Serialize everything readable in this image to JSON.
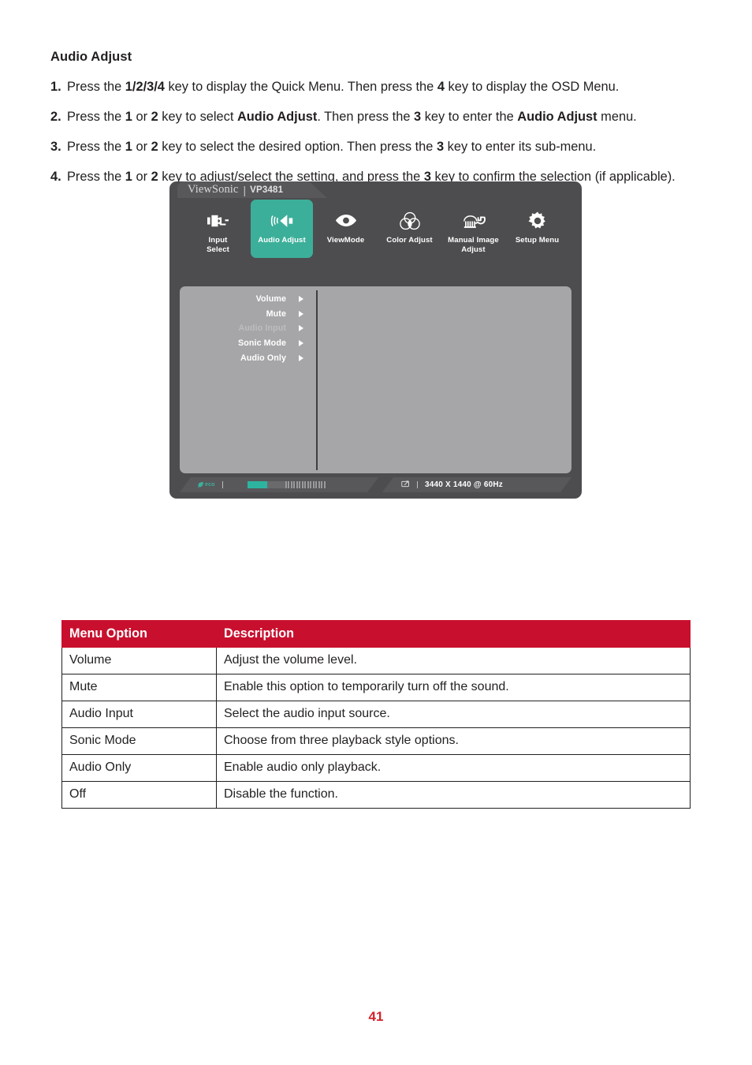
{
  "section": {
    "title": "Audio Adjust"
  },
  "steps": [
    {
      "num": "1.",
      "parts": [
        {
          "t": "Press the ",
          "b": false
        },
        {
          "t": "1/2/3/4",
          "b": true
        },
        {
          "t": " key to display the Quick Menu. Then press the ",
          "b": false
        },
        {
          "t": "4",
          "b": true
        },
        {
          "t": " key to display the OSD Menu.",
          "b": false
        }
      ]
    },
    {
      "num": "2.",
      "parts": [
        {
          "t": "Press the ",
          "b": false
        },
        {
          "t": "1",
          "b": true
        },
        {
          "t": " or ",
          "b": false
        },
        {
          "t": "2",
          "b": true
        },
        {
          "t": " key to select ",
          "b": false
        },
        {
          "t": "Audio Adjust",
          "b": true
        },
        {
          "t": ". Then press the ",
          "b": false
        },
        {
          "t": "3",
          "b": true
        },
        {
          "t": " key to enter the ",
          "b": false
        },
        {
          "t": "Audio Adjust",
          "b": true
        },
        {
          "t": " menu.",
          "b": false
        }
      ]
    },
    {
      "num": "3.",
      "parts": [
        {
          "t": "Press the ",
          "b": false
        },
        {
          "t": "1",
          "b": true
        },
        {
          "t": " or ",
          "b": false
        },
        {
          "t": "2",
          "b": true
        },
        {
          "t": " key to select the desired option. Then press the ",
          "b": false
        },
        {
          "t": "3",
          "b": true
        },
        {
          "t": " key to enter its sub-menu.",
          "b": false
        }
      ]
    },
    {
      "num": "4.",
      "parts": [
        {
          "t": "Press the ",
          "b": false
        },
        {
          "t": "1",
          "b": true
        },
        {
          "t": " or ",
          "b": false
        },
        {
          "t": "2",
          "b": true
        },
        {
          "t": " key to adjust/select the setting, and press the ",
          "b": false
        },
        {
          "t": "3",
          "b": true
        },
        {
          "t": " key to confirm the selection (if applicable).",
          "b": false
        }
      ]
    }
  ],
  "osd": {
    "brand": "ViewSonic",
    "separator": "|",
    "model": "VP3481",
    "tabs": [
      {
        "label": "Input\nSelect",
        "icon": "input-plug-icon",
        "active": false
      },
      {
        "label": "Audio Adjust",
        "icon": "speaker-waves-icon",
        "active": true
      },
      {
        "label": "ViewMode",
        "icon": "eye-icon",
        "active": false
      },
      {
        "label": "Color Adjust",
        "icon": "color-circles-icon",
        "active": false
      },
      {
        "label": "Manual Image\nAdjust",
        "icon": "sliders-wrench-icon",
        "active": false
      },
      {
        "label": "Setup Menu",
        "icon": "gear-icon",
        "active": false
      }
    ],
    "options": [
      {
        "label": "Volume",
        "disabled": false
      },
      {
        "label": "Mute",
        "disabled": false
      },
      {
        "label": "Audio Input",
        "disabled": true
      },
      {
        "label": "Sonic Mode",
        "disabled": false
      },
      {
        "label": "Audio Only",
        "disabled": false
      }
    ],
    "status": {
      "eco_label": "eco",
      "resolution": "3440 X 1440 @ 60Hz"
    },
    "colors": {
      "accent": "#3caf9a",
      "panel": "#4d4d4f",
      "body": "#a6a6a8"
    }
  },
  "table": {
    "headers": [
      "Menu Option",
      "Description"
    ],
    "rows": [
      [
        "Volume",
        "Adjust the volume level."
      ],
      [
        "Mute",
        "Enable this option to temporarily turn off the sound."
      ],
      [
        "Audio Input",
        "Select the audio input source."
      ],
      [
        "Sonic Mode",
        "Choose from three playback style options."
      ],
      [
        "Audio Only",
        "Enable audio only playback."
      ],
      [
        "Off",
        "Disable the function."
      ]
    ],
    "header_color": "#c8102e"
  },
  "footer": {
    "page_number": "41"
  }
}
